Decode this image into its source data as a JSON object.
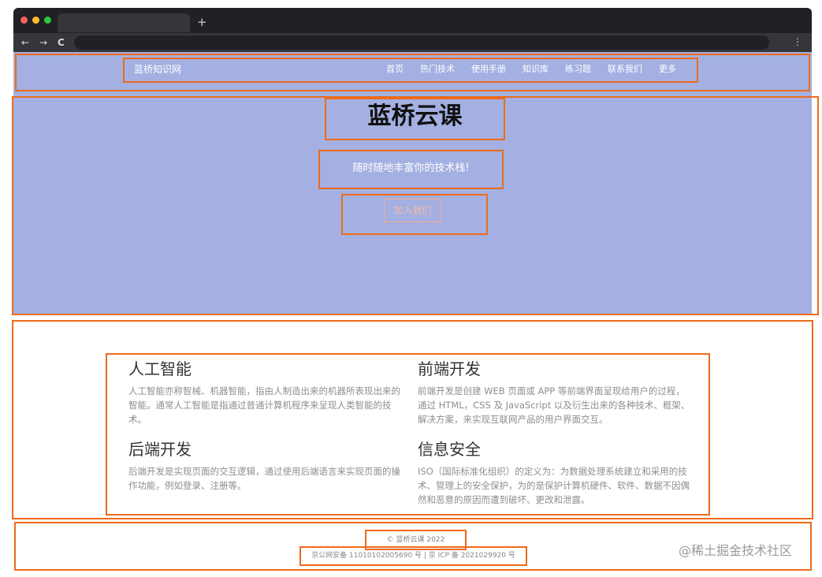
{
  "browser": {
    "new_tab": "+",
    "back": "←",
    "forward": "→",
    "reload": "C",
    "menu": "⋮"
  },
  "nav": {
    "brand": "蓝桥知识网",
    "links": [
      "首页",
      "热门技术",
      "使用手册",
      "知识库",
      "练习题",
      "联系我们",
      "更多"
    ]
  },
  "hero": {
    "title": "蓝桥云课",
    "subtitle": "随时随地丰富你的技术栈!",
    "button": "加入我们"
  },
  "cards": [
    {
      "title": "人工智能",
      "text": "人工智能亦称智械、机器智能，指由人制造出来的机器所表现出来的智能。通常人工智能是指通过普通计算机程序来呈现人类智能的技术。"
    },
    {
      "title": "前端开发",
      "text": "前端开发是创建 WEB 页面或 APP 等前端界面呈现给用户的过程，通过 HTML，CSS 及 JavaScript 以及衍生出来的各种技术、框架、解决方案，来实现互联网产品的用户界面交互。"
    },
    {
      "title": "后端开发",
      "text": "后端开发是实现页面的交互逻辑，通过使用后端语言来实现页面的操作功能，例如登录、注册等。"
    },
    {
      "title": "信息安全",
      "text": "ISO（国际标准化组织）的定义为：为数据处理系统建立和采用的技术、管理上的安全保护，为的是保护计算机硬件、软件、数据不因偶然和恶意的原因而遭到破坏、更改和泄露。"
    }
  ],
  "footer": {
    "copyright": "© 蓝桥云课 2022",
    "icp": "京公网安备 11010102005690 号 | 京 ICP 备 2021029920 号"
  },
  "watermark": "@稀土掘金技术社区",
  "colors": {
    "header_bg": "#a3b0e1",
    "annotation_border": "#ee6a1d"
  }
}
